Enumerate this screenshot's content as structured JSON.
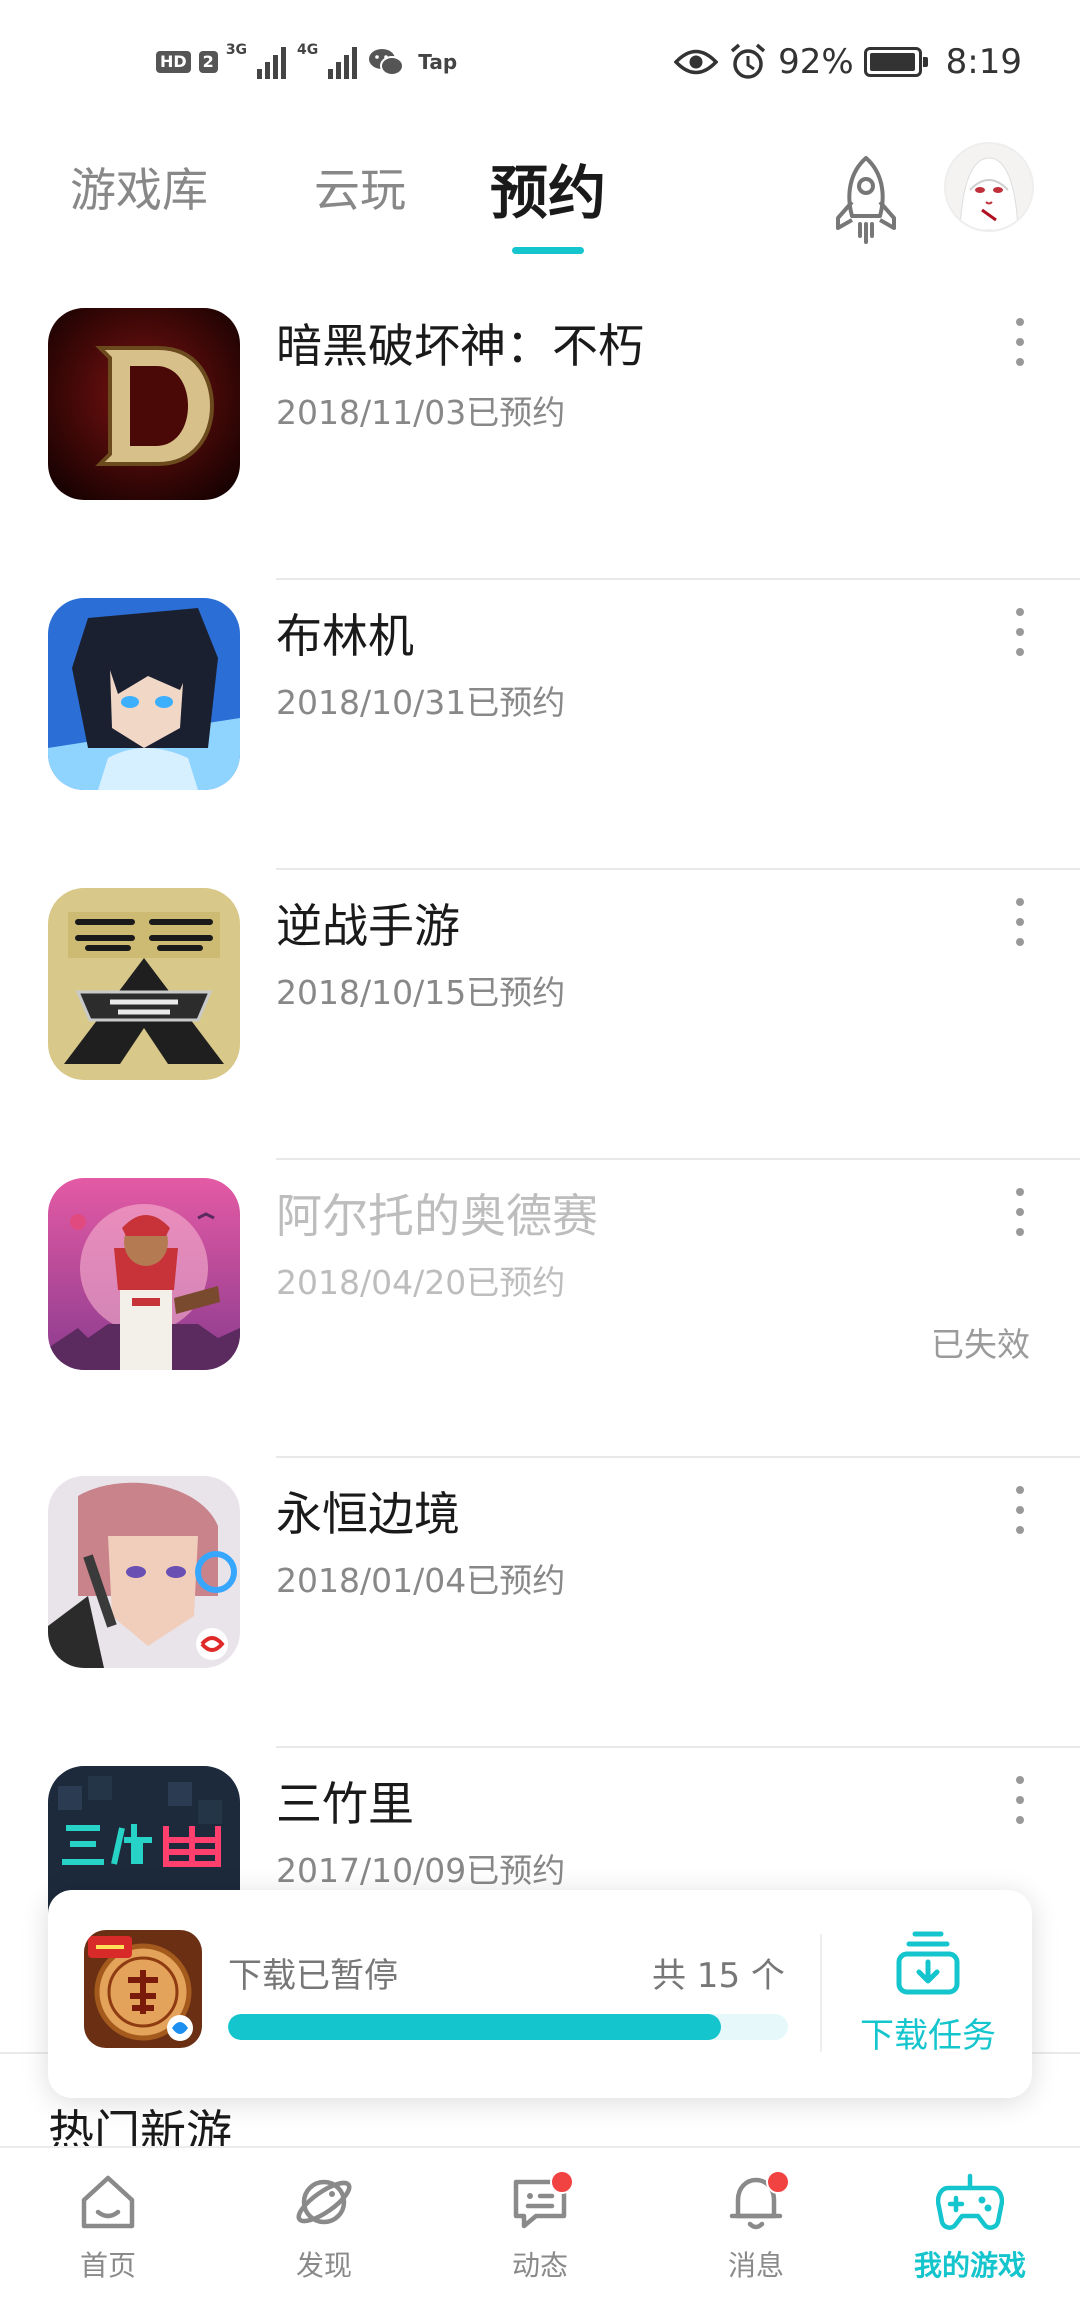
{
  "status_bar": {
    "hd_badge": "HD",
    "sim_slot": "2",
    "net_1": "3G",
    "net_2": "4G",
    "tap_label": "Tap",
    "battery": "92%",
    "time": "8:19"
  },
  "top_tabs": {
    "items": [
      {
        "label": "游戏库"
      },
      {
        "label": "云玩"
      },
      {
        "label": "预约"
      }
    ],
    "active": "预约"
  },
  "reservations": [
    {
      "name": "暗黑破坏神：不朽",
      "date": "2018/11/03已预约",
      "icon": "diablo-icon",
      "status": ""
    },
    {
      "name": "布林机",
      "date": "2018/10/31已预约",
      "icon": "anime-boy-icon",
      "status": ""
    },
    {
      "name": "逆战手游",
      "date": "2018/10/15已预约",
      "icon": "nizhan-icon",
      "status": ""
    },
    {
      "name": "阿尔托的奥德赛",
      "date": "2018/04/20已预约",
      "icon": "alto-icon",
      "status": "已失效"
    },
    {
      "name": "永恒边境",
      "date": "2018/01/04已预约",
      "icon": "cyber-girl-icon",
      "status": ""
    },
    {
      "name": "三竹里",
      "date": "2017/10/09已预约",
      "icon": "neon-text-icon",
      "status": ""
    }
  ],
  "download_card": {
    "status": "下载已暂停",
    "count": "共 15 个",
    "progress": 0.88,
    "task_label": "下载任务"
  },
  "hot_section": {
    "title": "热门新游"
  },
  "bottom_nav": {
    "items": [
      {
        "label": "首页",
        "icon": "home-icon"
      },
      {
        "label": "发现",
        "icon": "planet-icon"
      },
      {
        "label": "动态",
        "icon": "chat-icon",
        "badge": true
      },
      {
        "label": "消息",
        "icon": "bell-icon",
        "badge": true
      },
      {
        "label": "我的游戏",
        "icon": "gamepad-icon",
        "active": true
      }
    ]
  },
  "colors": {
    "accent": "#15c5ce",
    "badge": "#f24343"
  }
}
